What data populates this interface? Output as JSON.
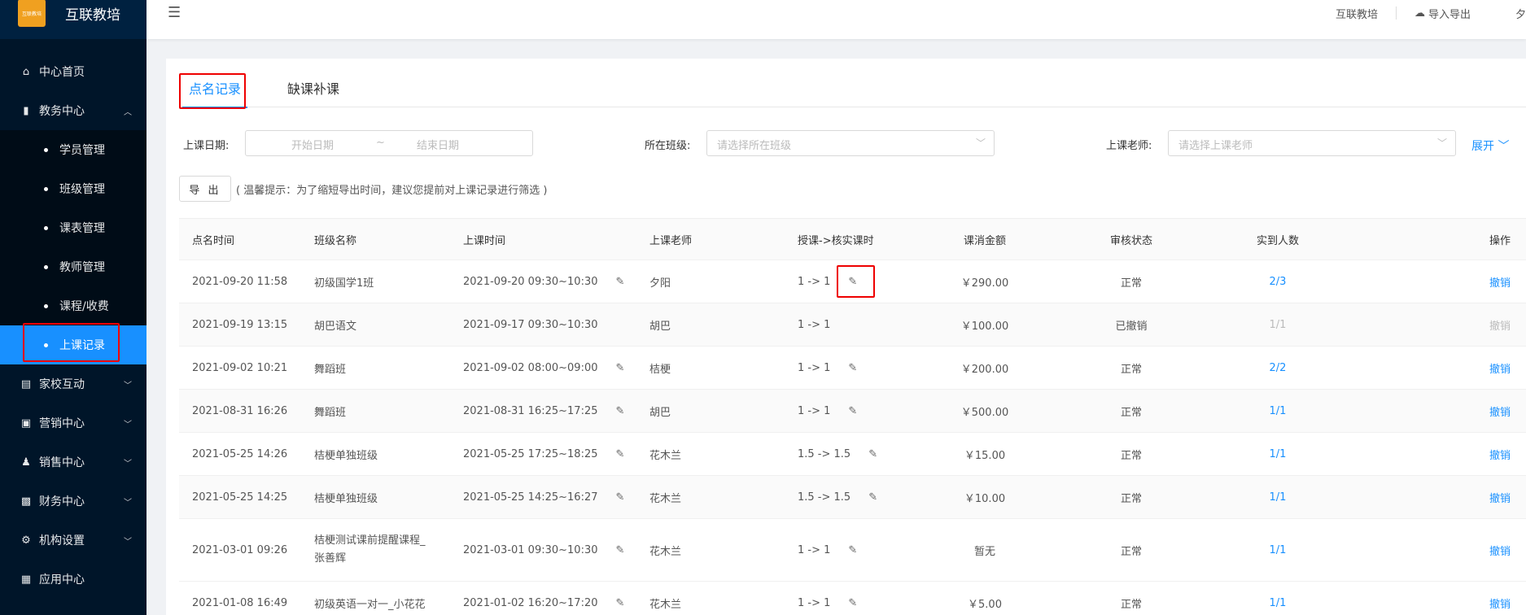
{
  "brand": {
    "title": "互联教培",
    "logo_text": "互联教培"
  },
  "sidebar": {
    "items": [
      {
        "label": "中心首页",
        "icon": "home-icon"
      },
      {
        "label": "教务中心",
        "icon": "book-icon",
        "caret": "up"
      },
      {
        "label": "学员管理",
        "sub": true
      },
      {
        "label": "班级管理",
        "sub": true
      },
      {
        "label": "课表管理",
        "sub": true
      },
      {
        "label": "教师管理",
        "sub": true
      },
      {
        "label": "课程/收费",
        "sub": true
      },
      {
        "label": "上课记录",
        "sub": true,
        "active": true
      },
      {
        "label": "家校互动",
        "icon": "chat-icon",
        "caret": "down"
      },
      {
        "label": "营销中心",
        "icon": "gift-icon",
        "caret": "down"
      },
      {
        "label": "销售中心",
        "icon": "users-icon",
        "caret": "down"
      },
      {
        "label": "财务中心",
        "icon": "wallet-icon",
        "caret": "down"
      },
      {
        "label": "机构设置",
        "icon": "gear-icon",
        "caret": "down"
      },
      {
        "label": "应用中心",
        "icon": "grid-icon"
      }
    ]
  },
  "header": {
    "org": "互联教培",
    "import_export": "导入导出",
    "user": "夕"
  },
  "tabs": {
    "active": "点名记录",
    "other": "缺课补课"
  },
  "filters": {
    "date_label": "上课日期:",
    "start_placeholder": "开始日期",
    "range_sep": "~",
    "end_placeholder": "结束日期",
    "class_label": "所在班级:",
    "class_placeholder": "请选择所在班级",
    "teacher_label": "上课老师:",
    "teacher_placeholder": "请选择上课老师",
    "expand": "展开"
  },
  "toolbar": {
    "export_label": "导 出",
    "hint": "( 温馨提示：为了缩短导出时间，建议您提前对上课记录进行筛选 )"
  },
  "table": {
    "columns": [
      "点名时间",
      "班级名称",
      "上课时间",
      "上课老师",
      "授课->核实课时",
      "课消金额",
      "审核状态",
      "实到人数",
      "操作"
    ],
    "rows": [
      {
        "roll_time": "2021-09-20 11:58",
        "class_name": "初级国学1班",
        "class_time": "2021-09-20 09:30~10:30",
        "teacher": "夕阳",
        "hours": "1 -> 1",
        "amount": "￥290.00",
        "status": "正常",
        "attendance": "2/3",
        "action": "撤销"
      },
      {
        "roll_time": "2021-09-19 13:15",
        "class_name": "胡巴语文",
        "class_time": "2021-09-17 09:30~10:30",
        "teacher": "胡巴",
        "hours": "1 -> 1",
        "amount": "￥100.00",
        "status": "已撤销",
        "attendance": "1/1",
        "action": "撤销"
      },
      {
        "roll_time": "2021-09-02 10:21",
        "class_name": "舞蹈班",
        "class_time": "2021-09-02 08:00~09:00",
        "teacher": "桔梗",
        "hours": "1 -> 1",
        "amount": "￥200.00",
        "status": "正常",
        "attendance": "2/2",
        "action": "撤销"
      },
      {
        "roll_time": "2021-08-31 16:26",
        "class_name": "舞蹈班",
        "class_time": "2021-08-31 16:25~17:25",
        "teacher": "胡巴",
        "hours": "1 -> 1",
        "amount": "￥500.00",
        "status": "正常",
        "attendance": "1/1",
        "action": "撤销"
      },
      {
        "roll_time": "2021-05-25 14:26",
        "class_name": "桔梗单独班级",
        "class_time": "2021-05-25 17:25~18:25",
        "teacher": "花木兰",
        "hours": "1.5 -> 1.5",
        "amount": "￥15.00",
        "status": "正常",
        "attendance": "1/1",
        "action": "撤销"
      },
      {
        "roll_time": "2021-05-25 14:25",
        "class_name": "桔梗单独班级",
        "class_time": "2021-05-25 14:25~16:27",
        "teacher": "花木兰",
        "hours": "1.5 -> 1.5",
        "amount": "￥10.00",
        "status": "正常",
        "attendance": "1/1",
        "action": "撤销"
      },
      {
        "roll_time": "2021-03-01 09:26",
        "class_name_line1": "桔梗测试课前提醒课程_",
        "class_name_line2": "张善辉",
        "class_time": "2021-03-01 09:30~10:30",
        "teacher": "花木兰",
        "hours": "1 -> 1",
        "amount": "暂无",
        "status": "正常",
        "attendance": "1/1",
        "action": "撤销"
      },
      {
        "roll_time": "2021-01-08 16:49",
        "class_name": "初级英语一对一_小花花",
        "class_time": "2021-01-02 16:20~17:20",
        "teacher": "花木兰",
        "hours": "1 -> 1",
        "amount": "￥5.00",
        "status": "正常",
        "attendance": "1/1",
        "action": "撤销"
      }
    ]
  }
}
